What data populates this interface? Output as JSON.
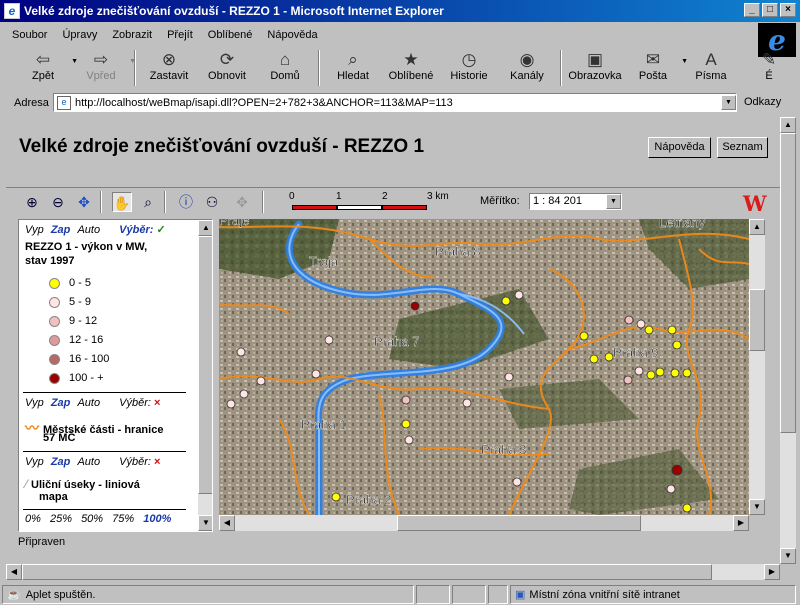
{
  "window": {
    "title": "Velké zdroje znečišťování ovzduší - REZZO 1 - Microsoft Internet Explorer",
    "controls": [
      "_",
      "□",
      "×"
    ]
  },
  "menu": [
    "Soubor",
    "Úpravy",
    "Zobrazit",
    "Přejít",
    "Oblíbené",
    "Nápověda"
  ],
  "toolbar": [
    {
      "label": "Zpět",
      "icon": "arrow-left-icon",
      "glyph": "⇦",
      "disabled": false,
      "dropdown": true
    },
    {
      "label": "Vpřed",
      "icon": "arrow-right-icon",
      "glyph": "⇨",
      "disabled": true,
      "dropdown": true
    },
    {
      "label": "Zastavit",
      "icon": "stop-icon",
      "glyph": "⊗",
      "disabled": false
    },
    {
      "label": "Obnovit",
      "icon": "refresh-icon",
      "glyph": "⟳",
      "disabled": false
    },
    {
      "label": "Domů",
      "icon": "home-icon",
      "glyph": "⌂",
      "disabled": false
    },
    {
      "label": "Hledat",
      "icon": "search-icon",
      "glyph": "⌕",
      "disabled": false
    },
    {
      "label": "Oblíbené",
      "icon": "favorites-icon",
      "glyph": "★",
      "disabled": false
    },
    {
      "label": "Historie",
      "icon": "history-icon",
      "glyph": "◷",
      "disabled": false
    },
    {
      "label": "Kanály",
      "icon": "channels-icon",
      "glyph": "◉",
      "disabled": false
    },
    {
      "label": "Obrazovka",
      "icon": "fullscreen-icon",
      "glyph": "▣",
      "disabled": false
    },
    {
      "label": "Pošta",
      "icon": "mail-icon",
      "glyph": "✉",
      "disabled": false,
      "dropdown": true
    },
    {
      "label": "Písma",
      "icon": "fonts-icon",
      "glyph": "A",
      "disabled": false
    },
    {
      "label": "É",
      "icon": "edit-icon",
      "glyph": "✎",
      "disabled": false
    }
  ],
  "address": {
    "label": "Adresa",
    "url": "http://localhost/weBmap/isapi.dll?OPEN=2+782+3&ANCHOR=113&MAP=113",
    "links_label": "Odkazy"
  },
  "page": {
    "title": "Velké zdroje znečišťování ovzduší - REZZO 1",
    "help_button": "Nápověda",
    "list_button": "Seznam",
    "status_text": "Připraven"
  },
  "map_tools": {
    "tools": [
      {
        "name": "zoom-in-icon",
        "glyph": "⊕"
      },
      {
        "name": "zoom-out-icon",
        "glyph": "⊖"
      },
      {
        "name": "pan-arrows-icon",
        "glyph": "✥"
      },
      {
        "name": "hand-pan-icon",
        "glyph": "✋"
      },
      {
        "name": "zoom-box-icon",
        "glyph": "⌕"
      },
      {
        "name": "info-icon",
        "glyph": "ⓘ"
      },
      {
        "name": "binoculars-icon",
        "glyph": "⚇"
      },
      {
        "name": "move-disabled-icon",
        "glyph": "✥"
      }
    ],
    "scale_ticks": [
      "0",
      "1",
      "2",
      "3 km"
    ],
    "scale_label": "Měřítko:",
    "scale_value": "1 : 84 201",
    "logo": "W"
  },
  "legend": {
    "header": {
      "vyp": "Vyp",
      "zap": "Zap",
      "auto": "Auto",
      "vyber": "Výběr:"
    },
    "layer1_title_line1": "REZZO 1 - výkon v MW,",
    "layer1_title_line2": "stav 1997",
    "classes": [
      {
        "label": "0 - 5",
        "color": "#ffff00"
      },
      {
        "label": "5 - 9",
        "color": "#ffe4e4"
      },
      {
        "label": "9 - 12",
        "color": "#f2c0c0"
      },
      {
        "label": "12 - 16",
        "color": "#e09a9a"
      },
      {
        "label": "16 - 100",
        "color": "#b86868"
      },
      {
        "label": "100 - +",
        "color": "#9a0000"
      }
    ],
    "layer2_title_line1": "Městské části - hranice",
    "layer2_title_line2": "57 MČ",
    "layer3_title_line1": "Uliční úseky - liniová",
    "layer3_title_line2": "mapa",
    "opacity": [
      "0%",
      "25%",
      "50%",
      "75%",
      "100%"
    ]
  },
  "map": {
    "labels": [
      "Praha 8",
      "Troja",
      "Praha 7",
      "Praha 9",
      "Praha 1",
      "Praha 3",
      "Praha 2",
      "Letňany",
      "Praje"
    ],
    "accent_river": "#2f7fe0",
    "accent_boundary": "#f08a18"
  },
  "statusbar": {
    "left": "Aplet spuštěn.",
    "zone": "Místní zóna vnitřní sítě intranet"
  }
}
